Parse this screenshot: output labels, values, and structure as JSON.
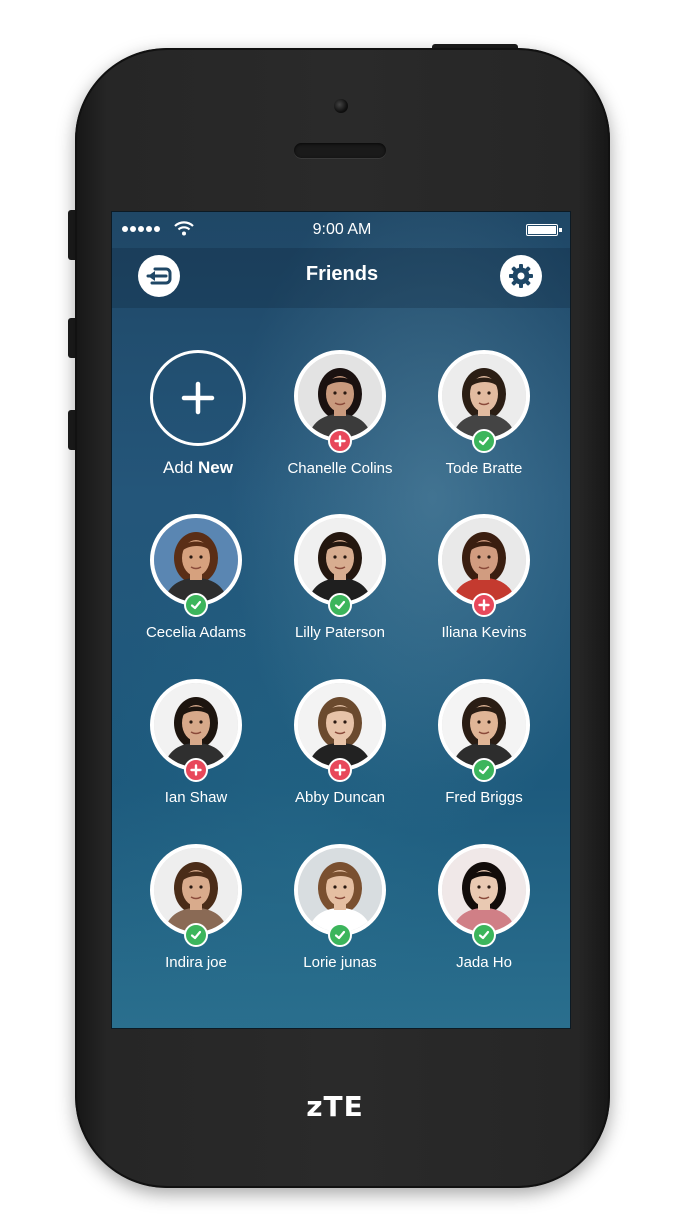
{
  "status_bar": {
    "time": "9:00 AM"
  },
  "nav": {
    "title": "Friends",
    "back_icon": "back-arrow-icon",
    "settings_icon": "gear-icon"
  },
  "add_new": {
    "label_light": "Add ",
    "label_bold": "New"
  },
  "friends": [
    {
      "name": "Chanelle Colins",
      "status": "add",
      "skin": "#c99a7e",
      "hair": "#1a1110",
      "bg": "#e3e3e3",
      "shirt": "#3b3b3b"
    },
    {
      "name": "Tode Bratte",
      "status": "ok",
      "skin": "#e2bba0",
      "hair": "#2b1e14",
      "bg": "#ececec",
      "shirt": "#444444"
    },
    {
      "name": "Cecelia Adams",
      "status": "ok",
      "skin": "#d6a17e",
      "hair": "#5a2e16",
      "bg": "#5a86b2",
      "shirt": "#2e2e2e"
    },
    {
      "name": "Lilly Paterson",
      "status": "ok",
      "skin": "#d8ad90",
      "hair": "#24170f",
      "bg": "#f0f0f0",
      "shirt": "#1f1f1f"
    },
    {
      "name": "Iliana Kevins",
      "status": "add",
      "skin": "#d19c80",
      "hair": "#3a1e10",
      "bg": "#e9e9e9",
      "shirt": "#c43a2f"
    },
    {
      "name": "Ian Shaw",
      "status": "add",
      "skin": "#d7a98a",
      "hair": "#1d150f",
      "bg": "#f2f2f2",
      "shirt": "#2f2f2f"
    },
    {
      "name": "Abby Duncan",
      "status": "add",
      "skin": "#e7c3a8",
      "hair": "#6b4a2e",
      "bg": "#f3f3f3",
      "shirt": "#222222"
    },
    {
      "name": "Fred Briggs",
      "status": "ok",
      "skin": "#e0b596",
      "hair": "#2a1d14",
      "bg": "#f4f4f4",
      "shirt": "#2d2d2d"
    },
    {
      "name": "Indira joe",
      "status": "ok",
      "skin": "#d9ab8c",
      "hair": "#4a2c18",
      "bg": "#eeeeee",
      "shirt": "#8a6a55"
    },
    {
      "name": "Lorie junas",
      "status": "ok",
      "skin": "#e5bfa2",
      "hair": "#7a5030",
      "bg": "#d8dde0",
      "shirt": "#ffffff"
    },
    {
      "name": "Jada Ho",
      "status": "ok",
      "skin": "#e9c9b2",
      "hair": "#120c0a",
      "bg": "#f0e8e8",
      "shirt": "#d07f86"
    }
  ],
  "device": {
    "brand": "zTE"
  }
}
